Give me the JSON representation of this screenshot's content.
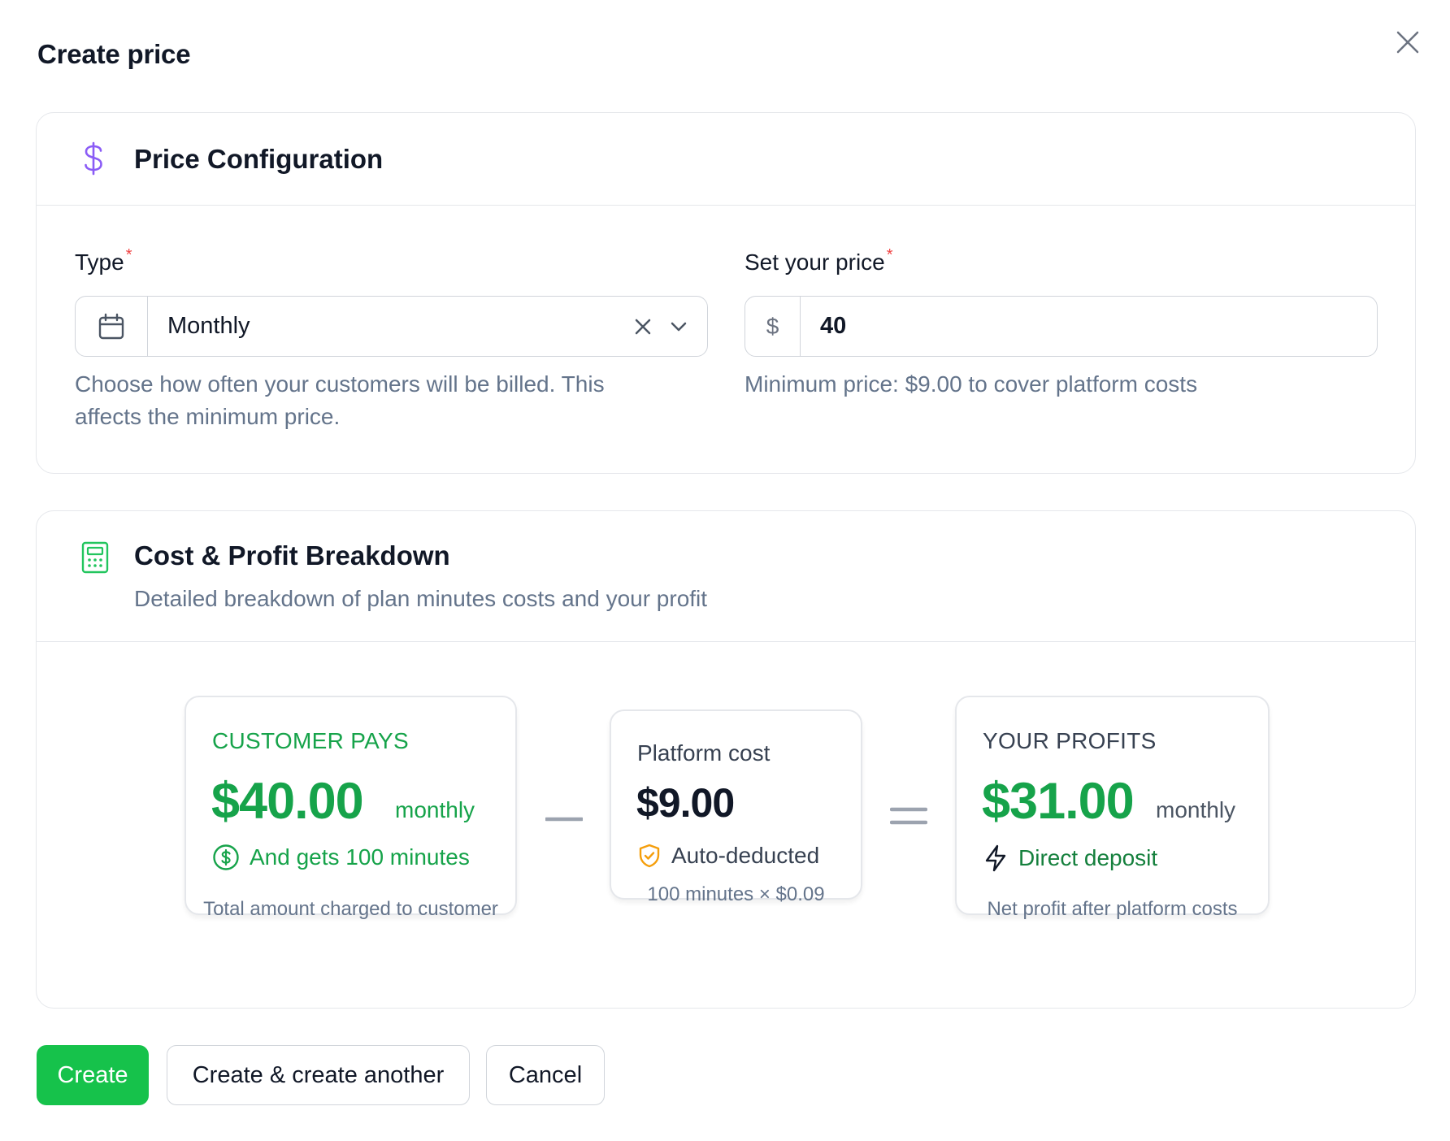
{
  "dialog": {
    "title": "Create price"
  },
  "config": {
    "title": "Price Configuration",
    "icon": "dollar-icon",
    "type_label": "Type",
    "required_mark": "*",
    "type_value": "Monthly",
    "type_help": "Choose how often your customers will be billed. This affects the minimum price.",
    "price_label": "Set your price",
    "currency_symbol": "$",
    "price_value": "40",
    "price_help": "Minimum price: $9.00 to cover platform costs"
  },
  "breakdown": {
    "title": "Cost & Profit Breakdown",
    "subtitle": "Detailed breakdown of plan minutes costs and your profit",
    "icon": "calculator-icon",
    "customer": {
      "label": "CUSTOMER PAYS",
      "amount": "$40.00",
      "period": "monthly",
      "note": "And gets 100 minutes",
      "caption": "Total amount charged to customer"
    },
    "platform": {
      "label": "Platform cost",
      "amount": "$9.00",
      "note": "Auto-deducted",
      "caption": "100 minutes × $0.09"
    },
    "profit": {
      "label": "YOUR PROFITS",
      "amount": "$31.00",
      "period": "monthly",
      "note": "Direct deposit",
      "caption": "Net profit after platform costs"
    }
  },
  "actions": {
    "create": "Create",
    "create_another": "Create & create another",
    "cancel": "Cancel"
  },
  "colors": {
    "accent_green": "#16c24b",
    "profit_green": "#16a34a",
    "dollar_purple": "#8b5cf6",
    "shield_amber": "#f59e0b",
    "required_red": "#ef4444"
  }
}
